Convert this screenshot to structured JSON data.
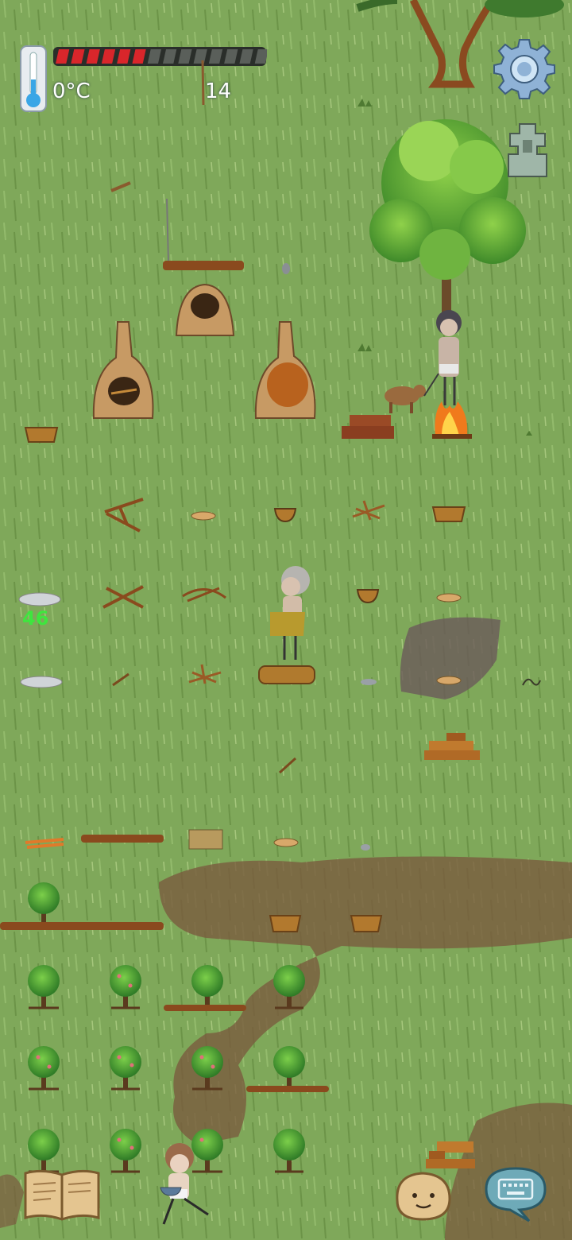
{
  "hud": {
    "temperature": "0°C",
    "age": "14",
    "food_filled": 6,
    "food_total": 14
  },
  "overlay": {
    "item_count": "46"
  },
  "colors": {
    "grass": "#7fa85a",
    "food_fill": "#d9262b",
    "food_empty": "#5a5f5a",
    "count_text": "#3ee63e",
    "mud": "#7a5a3e"
  },
  "icons": {
    "thermometer": "thermometer-icon",
    "settings": "gear-icon",
    "totem": "totem-icon",
    "recipe_book": "book-icon",
    "emote": "emote-face-icon",
    "chat": "keyboard-icon"
  }
}
